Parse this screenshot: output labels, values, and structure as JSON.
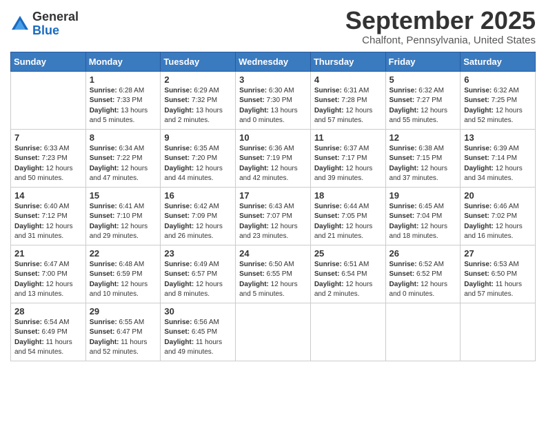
{
  "logo": {
    "general": "General",
    "blue": "Blue"
  },
  "title": "September 2025",
  "location": "Chalfont, Pennsylvania, United States",
  "weekdays": [
    "Sunday",
    "Monday",
    "Tuesday",
    "Wednesday",
    "Thursday",
    "Friday",
    "Saturday"
  ],
  "weeks": [
    [
      {
        "day": "",
        "info": ""
      },
      {
        "day": "1",
        "info": "Sunrise: 6:28 AM\nSunset: 7:33 PM\nDaylight: 13 hours\nand 5 minutes."
      },
      {
        "day": "2",
        "info": "Sunrise: 6:29 AM\nSunset: 7:32 PM\nDaylight: 13 hours\nand 2 minutes."
      },
      {
        "day": "3",
        "info": "Sunrise: 6:30 AM\nSunset: 7:30 PM\nDaylight: 13 hours\nand 0 minutes."
      },
      {
        "day": "4",
        "info": "Sunrise: 6:31 AM\nSunset: 7:28 PM\nDaylight: 12 hours\nand 57 minutes."
      },
      {
        "day": "5",
        "info": "Sunrise: 6:32 AM\nSunset: 7:27 PM\nDaylight: 12 hours\nand 55 minutes."
      },
      {
        "day": "6",
        "info": "Sunrise: 6:32 AM\nSunset: 7:25 PM\nDaylight: 12 hours\nand 52 minutes."
      }
    ],
    [
      {
        "day": "7",
        "info": "Sunrise: 6:33 AM\nSunset: 7:23 PM\nDaylight: 12 hours\nand 50 minutes."
      },
      {
        "day": "8",
        "info": "Sunrise: 6:34 AM\nSunset: 7:22 PM\nDaylight: 12 hours\nand 47 minutes."
      },
      {
        "day": "9",
        "info": "Sunrise: 6:35 AM\nSunset: 7:20 PM\nDaylight: 12 hours\nand 44 minutes."
      },
      {
        "day": "10",
        "info": "Sunrise: 6:36 AM\nSunset: 7:19 PM\nDaylight: 12 hours\nand 42 minutes."
      },
      {
        "day": "11",
        "info": "Sunrise: 6:37 AM\nSunset: 7:17 PM\nDaylight: 12 hours\nand 39 minutes."
      },
      {
        "day": "12",
        "info": "Sunrise: 6:38 AM\nSunset: 7:15 PM\nDaylight: 12 hours\nand 37 minutes."
      },
      {
        "day": "13",
        "info": "Sunrise: 6:39 AM\nSunset: 7:14 PM\nDaylight: 12 hours\nand 34 minutes."
      }
    ],
    [
      {
        "day": "14",
        "info": "Sunrise: 6:40 AM\nSunset: 7:12 PM\nDaylight: 12 hours\nand 31 minutes."
      },
      {
        "day": "15",
        "info": "Sunrise: 6:41 AM\nSunset: 7:10 PM\nDaylight: 12 hours\nand 29 minutes."
      },
      {
        "day": "16",
        "info": "Sunrise: 6:42 AM\nSunset: 7:09 PM\nDaylight: 12 hours\nand 26 minutes."
      },
      {
        "day": "17",
        "info": "Sunrise: 6:43 AM\nSunset: 7:07 PM\nDaylight: 12 hours\nand 23 minutes."
      },
      {
        "day": "18",
        "info": "Sunrise: 6:44 AM\nSunset: 7:05 PM\nDaylight: 12 hours\nand 21 minutes."
      },
      {
        "day": "19",
        "info": "Sunrise: 6:45 AM\nSunset: 7:04 PM\nDaylight: 12 hours\nand 18 minutes."
      },
      {
        "day": "20",
        "info": "Sunrise: 6:46 AM\nSunset: 7:02 PM\nDaylight: 12 hours\nand 16 minutes."
      }
    ],
    [
      {
        "day": "21",
        "info": "Sunrise: 6:47 AM\nSunset: 7:00 PM\nDaylight: 12 hours\nand 13 minutes."
      },
      {
        "day": "22",
        "info": "Sunrise: 6:48 AM\nSunset: 6:59 PM\nDaylight: 12 hours\nand 10 minutes."
      },
      {
        "day": "23",
        "info": "Sunrise: 6:49 AM\nSunset: 6:57 PM\nDaylight: 12 hours\nand 8 minutes."
      },
      {
        "day": "24",
        "info": "Sunrise: 6:50 AM\nSunset: 6:55 PM\nDaylight: 12 hours\nand 5 minutes."
      },
      {
        "day": "25",
        "info": "Sunrise: 6:51 AM\nSunset: 6:54 PM\nDaylight: 12 hours\nand 2 minutes."
      },
      {
        "day": "26",
        "info": "Sunrise: 6:52 AM\nSunset: 6:52 PM\nDaylight: 12 hours\nand 0 minutes."
      },
      {
        "day": "27",
        "info": "Sunrise: 6:53 AM\nSunset: 6:50 PM\nDaylight: 11 hours\nand 57 minutes."
      }
    ],
    [
      {
        "day": "28",
        "info": "Sunrise: 6:54 AM\nSunset: 6:49 PM\nDaylight: 11 hours\nand 54 minutes."
      },
      {
        "day": "29",
        "info": "Sunrise: 6:55 AM\nSunset: 6:47 PM\nDaylight: 11 hours\nand 52 minutes."
      },
      {
        "day": "30",
        "info": "Sunrise: 6:56 AM\nSunset: 6:45 PM\nDaylight: 11 hours\nand 49 minutes."
      },
      {
        "day": "",
        "info": ""
      },
      {
        "day": "",
        "info": ""
      },
      {
        "day": "",
        "info": ""
      },
      {
        "day": "",
        "info": ""
      }
    ]
  ]
}
